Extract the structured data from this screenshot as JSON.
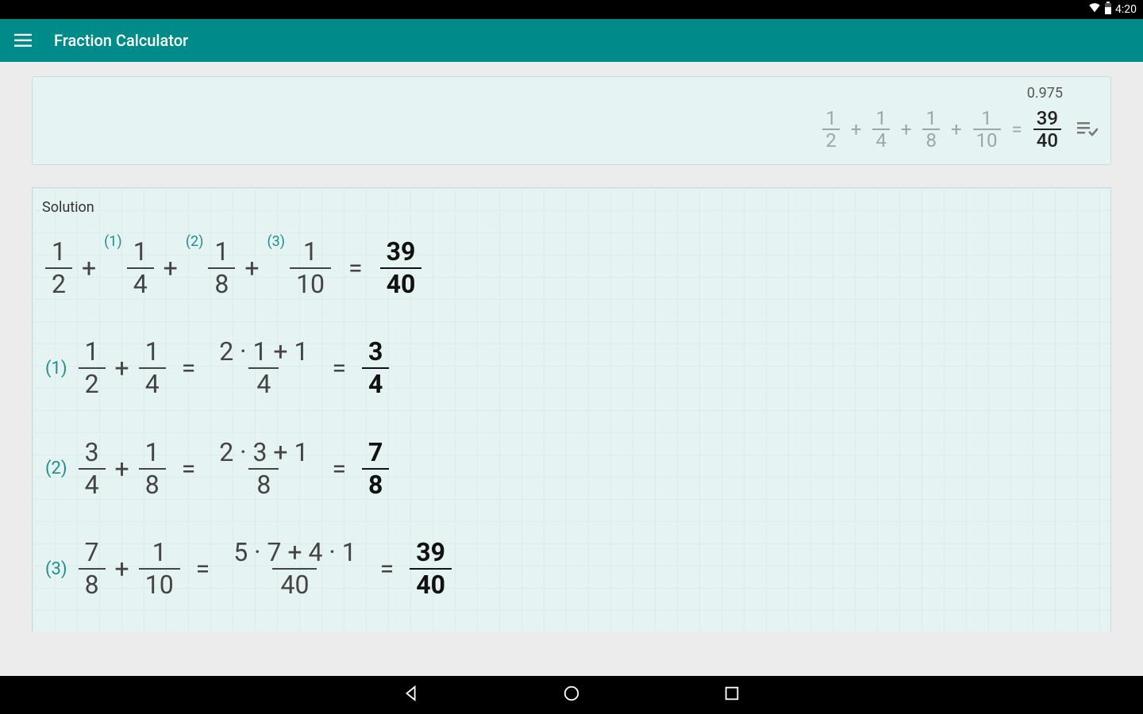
{
  "status": {
    "time": "4:20"
  },
  "appbar": {
    "title": "Fraction Calculator"
  },
  "result": {
    "decimal": "0.975",
    "terms": [
      {
        "n": "1",
        "d": "2"
      },
      {
        "n": "1",
        "d": "4"
      },
      {
        "n": "1",
        "d": "8"
      },
      {
        "n": "1",
        "d": "10"
      }
    ],
    "answer": {
      "n": "39",
      "d": "40"
    },
    "plus": "+",
    "equals": "="
  },
  "solution": {
    "title": "Solution",
    "summary": {
      "terms": [
        {
          "n": "1",
          "d": "2"
        },
        {
          "n": "1",
          "d": "4"
        },
        {
          "n": "1",
          "d": "8"
        },
        {
          "n": "1",
          "d": "10"
        }
      ],
      "refs": [
        "(1)",
        "(2)",
        "(3)"
      ],
      "answer": {
        "n": "39",
        "d": "40"
      }
    },
    "steps": [
      {
        "label": "(1)",
        "a": {
          "n": "1",
          "d": "2"
        },
        "b": {
          "n": "1",
          "d": "4"
        },
        "work": {
          "num": "2 · 1 + 1",
          "den": "4"
        },
        "ans": {
          "n": "3",
          "d": "4"
        }
      },
      {
        "label": "(2)",
        "a": {
          "n": "3",
          "d": "4"
        },
        "b": {
          "n": "1",
          "d": "8"
        },
        "work": {
          "num": "2 · 3 + 1",
          "den": "8"
        },
        "ans": {
          "n": "7",
          "d": "8"
        }
      },
      {
        "label": "(3)",
        "a": {
          "n": "7",
          "d": "8"
        },
        "b": {
          "n": "1",
          "d": "10"
        },
        "work": {
          "num": "5 · 7 + 4 · 1",
          "den": "40"
        },
        "ans": {
          "n": "39",
          "d": "40"
        }
      }
    ],
    "plus": "+",
    "equals": "="
  }
}
